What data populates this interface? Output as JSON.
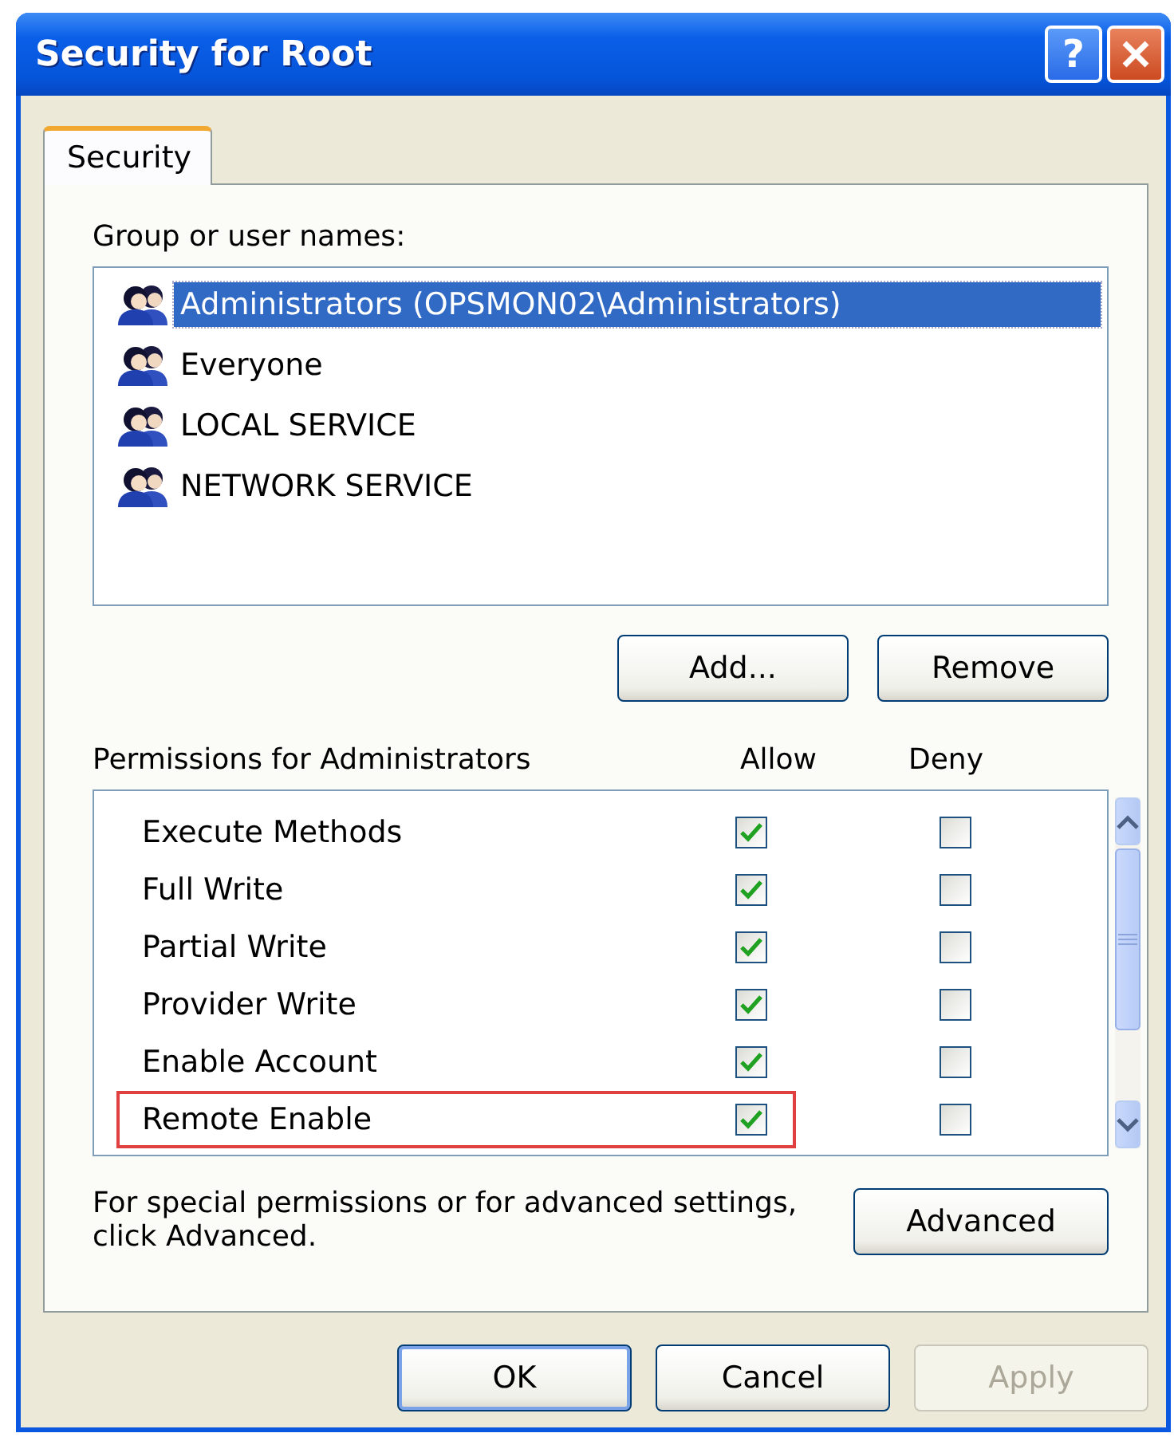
{
  "window": {
    "title": "Security for Root",
    "help_label": "?"
  },
  "tabs": [
    {
      "label": "Security",
      "selected": true
    }
  ],
  "group_list": {
    "label": "Group or user names:",
    "items": [
      {
        "name": "Administrators (OPSMON02\\Administrators)",
        "selected": true
      },
      {
        "name": "Everyone",
        "selected": false
      },
      {
        "name": "LOCAL SERVICE",
        "selected": false
      },
      {
        "name": "NETWORK SERVICE",
        "selected": false
      }
    ]
  },
  "group_buttons": [
    {
      "label": "Add...",
      "disabled": false
    },
    {
      "label": "Remove",
      "disabled": false
    }
  ],
  "permissions": {
    "label": "Permissions for Administrators",
    "columns": [
      "Allow",
      "Deny"
    ],
    "rows": [
      {
        "name": "Execute Methods",
        "allow": true,
        "deny": false,
        "highlighted": false
      },
      {
        "name": "Full Write",
        "allow": true,
        "deny": false,
        "highlighted": false
      },
      {
        "name": "Partial Write",
        "allow": true,
        "deny": false,
        "highlighted": false
      },
      {
        "name": "Provider Write",
        "allow": true,
        "deny": false,
        "highlighted": false
      },
      {
        "name": "Enable Account",
        "allow": true,
        "deny": false,
        "highlighted": false
      },
      {
        "name": "Remote Enable",
        "allow": true,
        "deny": false,
        "highlighted": true
      }
    ]
  },
  "advanced": {
    "text": "For special permissions or for advanced settings, click Advanced.",
    "button": "Advanced"
  },
  "buttons": [
    {
      "label": "OK",
      "disabled": false,
      "default": true
    },
    {
      "label": "Cancel",
      "disabled": false,
      "default": false
    },
    {
      "label": "Apply",
      "disabled": true,
      "default": false
    }
  ]
}
